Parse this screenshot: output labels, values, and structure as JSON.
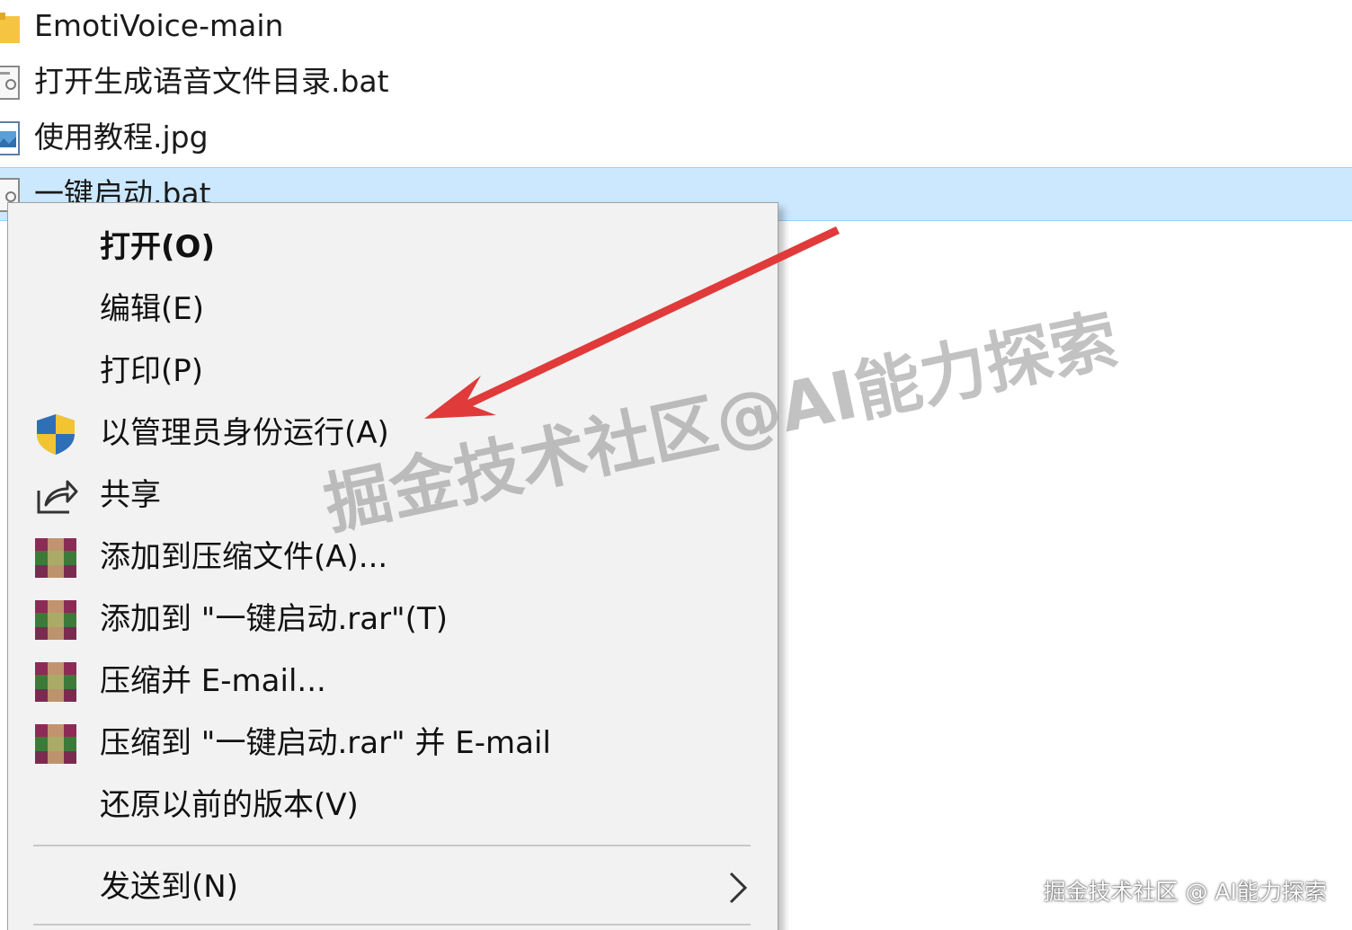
{
  "files": [
    {
      "name": "EmotiVoice-main",
      "icon": "folder-icon",
      "selected": false
    },
    {
      "name": "打开生成语音文件目录.bat",
      "icon": "bat-file-icon",
      "selected": false
    },
    {
      "name": "使用教程.jpg",
      "icon": "image-file-icon",
      "selected": false
    },
    {
      "name": "一键启动.bat",
      "icon": "bat-file-icon",
      "selected": true
    }
  ],
  "context_menu": {
    "items": [
      {
        "label": "打开(O)",
        "icon": "",
        "bold": true
      },
      {
        "label": "编辑(E)",
        "icon": ""
      },
      {
        "label": "打印(P)",
        "icon": ""
      },
      {
        "label": "以管理员身份运行(A)",
        "icon": "uac-shield-icon"
      },
      {
        "label": "共享",
        "icon": "share-icon"
      },
      {
        "label": "添加到压缩文件(A)...",
        "icon": "winrar-icon"
      },
      {
        "label": "添加到 \"一键启动.rar\"(T)",
        "icon": "winrar-icon"
      },
      {
        "label": "压缩并 E-mail...",
        "icon": "winrar-icon"
      },
      {
        "label": "压缩到 \"一键启动.rar\" 并 E-mail",
        "icon": "winrar-icon"
      },
      {
        "label": "还原以前的版本(V)",
        "icon": ""
      },
      {
        "label": "发送到(N)",
        "icon": "",
        "submenu": true
      }
    ]
  },
  "annotation": {
    "arrow_color": "#e03a3a"
  },
  "watermark": {
    "center": "掘金技术社区@AI能力探索",
    "footer": "掘金技术社区 @ AI能力探索"
  },
  "colors": {
    "selection": "#cce8ff",
    "menu_background": "#f2f2f2"
  }
}
